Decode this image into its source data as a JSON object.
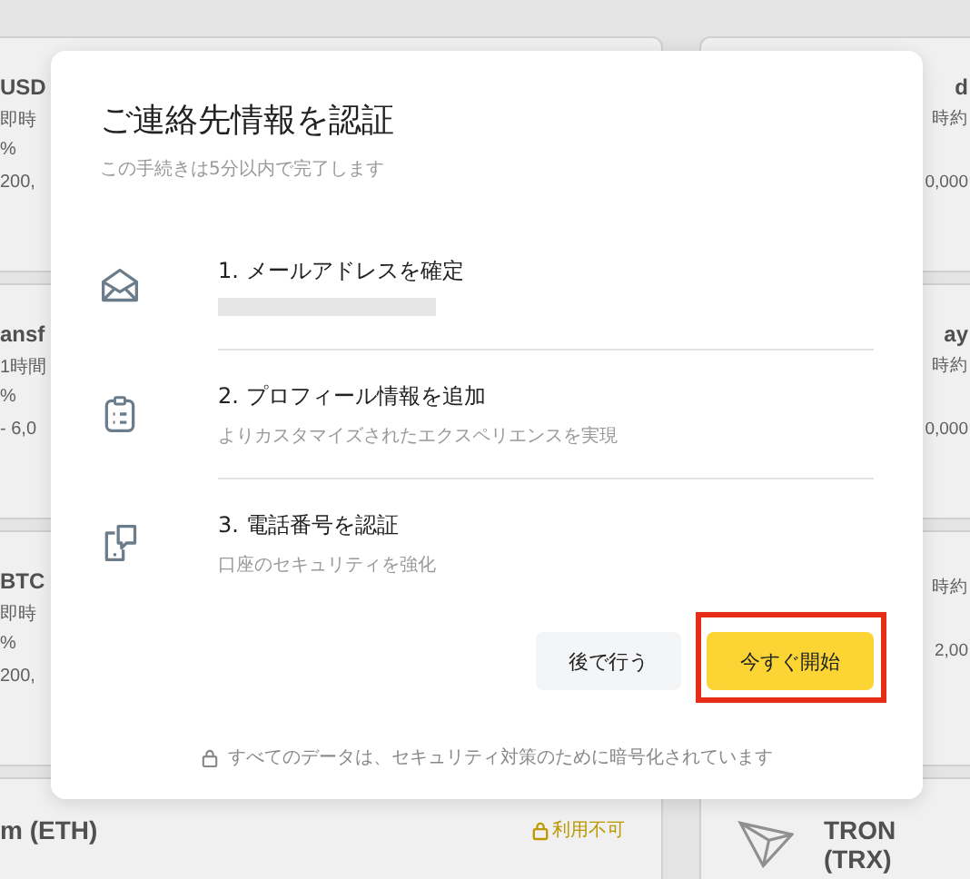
{
  "background": {
    "left_cards": [
      {
        "title": "USD",
        "lines": [
          "即時",
          "%",
          "200,"
        ]
      },
      {
        "title": "ansf",
        "lines": [
          "1時間",
          "%",
          "- 6,0"
        ]
      },
      {
        "title": "BTC",
        "lines": [
          "即時",
          "%",
          "200,"
        ]
      },
      {
        "title": "m (ETH)",
        "badge": "利用不可"
      }
    ],
    "right_cards": [
      {
        "title": "d",
        "lines": [
          "時約",
          "0,000"
        ]
      },
      {
        "title": "ay",
        "lines": [
          "時約",
          "0,000"
        ]
      },
      {
        "lines": [
          "時約",
          "2,00"
        ]
      },
      {
        "title": "TRON (TRX)",
        "logo": true
      }
    ]
  },
  "dialog": {
    "title": "ご連絡先情報を認証",
    "subtitle": "この手続きは5分以内で完了します",
    "steps": [
      {
        "kind": "mail",
        "label": "1. メールアドレスを確定",
        "redacted": true
      },
      {
        "kind": "clipboard",
        "label": "2. プロフィール情報を追加",
        "description": "よりカスタマイズされたエクスペリエンスを実現"
      },
      {
        "kind": "phone",
        "label": "3. 電話番号を認証",
        "description": "口座のセキュリティを強化"
      }
    ],
    "buttons": [
      {
        "kind": "secondary",
        "label": "後で行う",
        "highlighted": false
      },
      {
        "kind": "primary",
        "label": "今すぐ開始",
        "highlighted": true
      }
    ],
    "footer": "すべてのデータは、セキュリティ対策のために暗号化されています"
  }
}
